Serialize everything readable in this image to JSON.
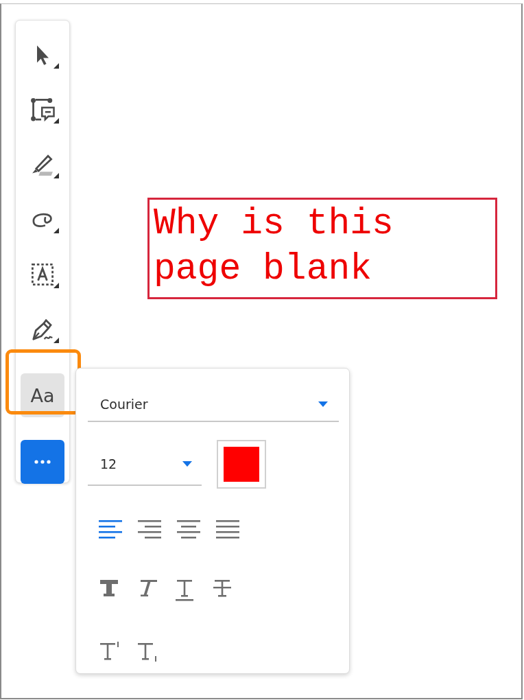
{
  "toolbar": {
    "tools": [
      {
        "kind": "select",
        "selected": false
      },
      {
        "kind": "comment-box",
        "selected": false
      },
      {
        "kind": "highlighter",
        "selected": false
      },
      {
        "kind": "lasso",
        "selected": false
      },
      {
        "kind": "text-field",
        "selected": false
      },
      {
        "kind": "pen",
        "selected": false
      },
      {
        "kind": "text-format",
        "label": "Aa",
        "selected": true,
        "highlighted": true
      },
      {
        "kind": "more",
        "selected": false
      }
    ]
  },
  "text_box": {
    "lines": [
      "Why is this",
      "page blank"
    ],
    "color": "#ee0000"
  },
  "format_panel": {
    "font": {
      "value": "Courier"
    },
    "size": {
      "value": "12"
    },
    "color": "#ff0000",
    "alignments": [
      {
        "kind": "left",
        "selected": true
      },
      {
        "kind": "right",
        "selected": false
      },
      {
        "kind": "center",
        "selected": false
      },
      {
        "kind": "justify",
        "selected": false
      }
    ],
    "styles": [
      {
        "kind": "bold"
      },
      {
        "kind": "italic"
      },
      {
        "kind": "underline"
      },
      {
        "kind": "strikethrough"
      }
    ],
    "scripts": [
      {
        "kind": "superscript"
      },
      {
        "kind": "subscript"
      }
    ]
  }
}
